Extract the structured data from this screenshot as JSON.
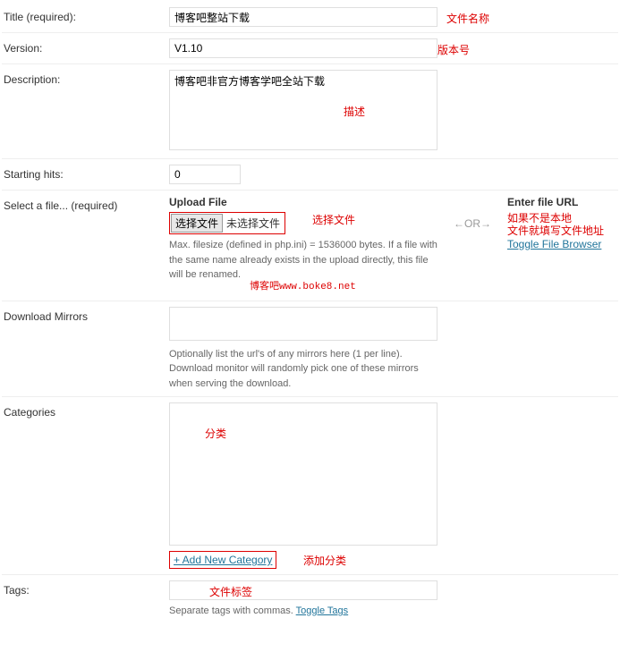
{
  "title": {
    "label": "Title (required):",
    "value": "博客吧整站下载",
    "anno": "文件名称"
  },
  "version": {
    "label": "Version:",
    "value": "V1.10",
    "anno": "版本号"
  },
  "description": {
    "label": "Description:",
    "value": "博客吧非官方博客学吧全站下载",
    "anno": "描述"
  },
  "hits": {
    "label": "Starting hits:",
    "value": "0"
  },
  "file": {
    "label": "Select a file... (required)",
    "upload": {
      "heading": "Upload File",
      "button": "选择文件",
      "status": "未选择文件",
      "anno": "选择文件",
      "help": "Max. filesize (defined in php.ini) = 1536000 bytes. If a file with the same name already exists in the upload directly, this file will be renamed.",
      "watermark": "博客吧www.boke8.net"
    },
    "or": "←OR→",
    "url": {
      "heading": "Enter file URL",
      "anno_line1": "如果不是本地",
      "anno_line2": "文件就填写文件地址",
      "toggle": "Toggle File Browser"
    }
  },
  "mirrors": {
    "label": "Download Mirrors",
    "help": "Optionally list the url's of any mirrors here (1 per line). Download monitor will randomly pick one of these mirrors when serving the download."
  },
  "categories": {
    "label": "Categories",
    "anno": "分类",
    "add": "+ Add New Category",
    "add_anno": "添加分类"
  },
  "tags": {
    "label": "Tags:",
    "anno": "文件标签",
    "help_pre": "Separate tags with commas. ",
    "toggle": "Toggle Tags"
  }
}
